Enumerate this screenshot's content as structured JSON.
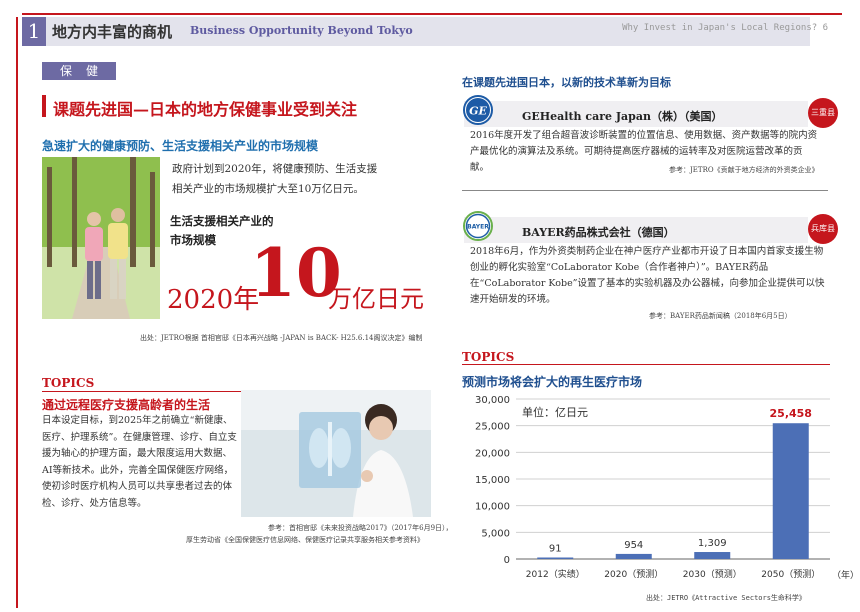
{
  "header": {
    "page_num": "1",
    "title": "地方内丰富的商机",
    "subtitle": "Business Opportunity Beyond Tokyo",
    "right": "Why Invest in Japan's Local Regions? 6"
  },
  "left": {
    "category": "保健",
    "main_title": "课题先进国—日本的地方保健事业受到关注",
    "sub_title": "急速扩大的健康预防、生活支援相关产业的市场规模",
    "market_text_1": "政府计划到2020年，将健康预防、生活支援",
    "market_text_2": "相关产业的市场规模扩大至10万亿日元。",
    "market_label_1": "生活支援相关产业的",
    "market_label_2": "市场规模",
    "big_year": "2020年",
    "big_number": "10",
    "big_unit": "万亿日元",
    "source": "出处：JETRO根据 首相官邸《日本再兴战略 -JAPAN is BACK- H25.6.14阁议决定》编制",
    "topics_label": "TOPICS",
    "topics_title": "通过远程医疗支援高龄者的生活",
    "topics_body": "日本设定目标，到2025年之前确立“新健康、医疗、护理系统”。在健康管理、诊疗、自立支援为轴心的护理方面，最大限度运用大数据、AI等新技术。此外，完善全国保健医疗网络，使初诊时医疗机构人员可以共享患者过去的体检、诊疗、处方信息等。",
    "topics_source_1": "参考：首相官邸《未来投资战略2017》（2017年6月9日），",
    "topics_source_2": "厚生劳动省《全国保健医疗信息网络、保健医疗记录共享服务相关参考资料》"
  },
  "right": {
    "heading": "在课题先进国日本，以新的技术革新为目标",
    "companies": [
      {
        "icon": "ge-logo-icon",
        "icon_text": "GE",
        "name": "GEHealth care Japan（株）（美国）",
        "badge": "三重县",
        "body": "2016年度开发了组合超音波诊断装置的位置信息、使用数据、资产数据等的院内资产最优化的演算法及系统。可期待提高医疗器械的运转率及对医院运营改革的贡献。",
        "ref": "参考：JETRO《贡献于地方经济的外资类企业》"
      },
      {
        "icon": "bayer-logo-icon",
        "icon_text": "BAYER",
        "name": "BAYER药品株式会社（德国）",
        "badge": "兵库县",
        "body": "2018年6月，作为外资类制药企业在神户医疗产业都市开设了日本国内首家支援生物创业的孵化实验室“CoLaborator Kobe（合作者神户）”。BAYER药品在“CoLaborator Kobe”设置了基本的实验机器及办公器械，向参加企业提供可以快速开始研发的环境。",
        "ref": "参考：BAYER药品新闻稿（2018年6月5日）"
      }
    ],
    "topics_label": "TOPICS",
    "topics_title": "预测市场将会扩大的再生医疗市场"
  },
  "chart_data": {
    "type": "bar",
    "unit_label": "单位：亿日元",
    "categories": [
      "2012（实绩）",
      "2020（预测）",
      "2030（预测）",
      "2050（预测）"
    ],
    "values": [
      91,
      954,
      1309,
      25458
    ],
    "value_labels": [
      "91",
      "954",
      "1,309",
      "25,458"
    ],
    "ylim": [
      0,
      30000
    ],
    "yticks": [
      "0",
      "5,000",
      "10,000",
      "15,000",
      "20,000",
      "25,000",
      "30,000"
    ],
    "xlabel": "（年）",
    "bar_color": "#4c6fb6",
    "highlight_label_color": "#c5161d",
    "source": "出处：JETRO《Attractive Sectors生命科学》"
  }
}
